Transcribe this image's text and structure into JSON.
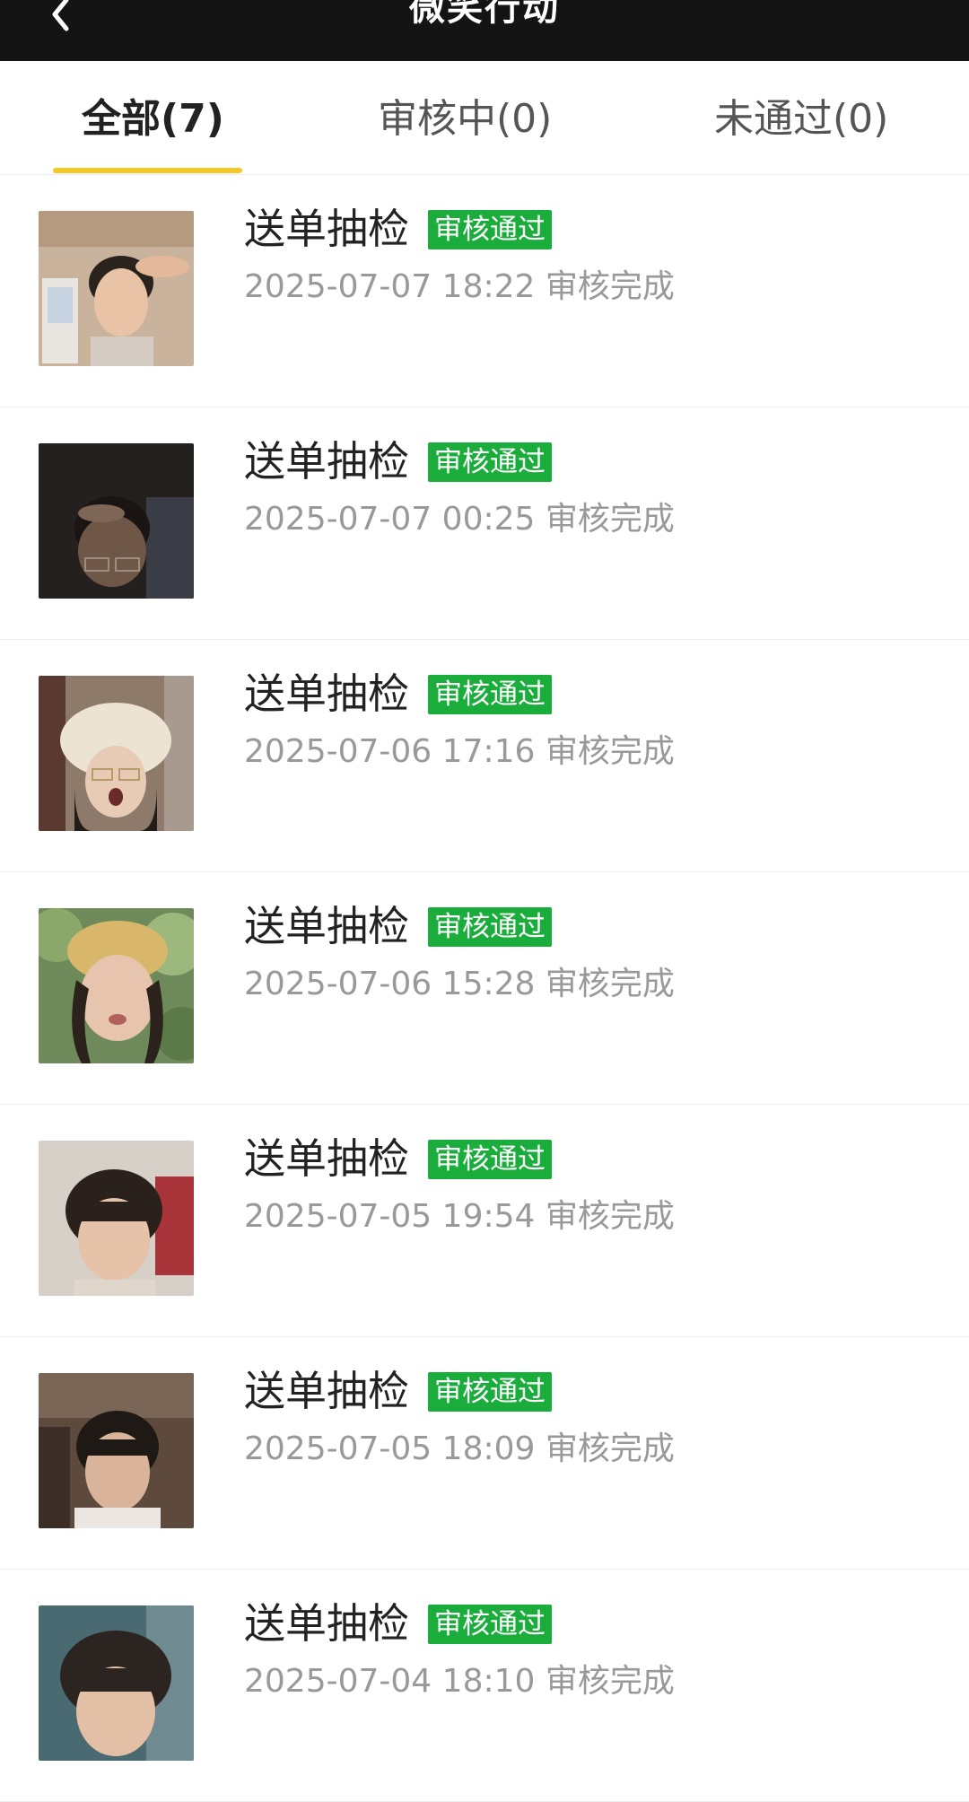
{
  "header": {
    "title": "微笑行动"
  },
  "tabs": [
    {
      "label": "全部(7)",
      "active": true
    },
    {
      "label": "审核中(0)",
      "active": false
    },
    {
      "label": "未通过(0)",
      "active": false
    }
  ],
  "colors": {
    "header_bg": "#141414",
    "tab_indicator": "#f6c823",
    "badge_bg": "#1aad3c",
    "subtext": "#999999"
  },
  "items": [
    {
      "title": "送单抽检",
      "badge": "审核通过",
      "subtitle": "2025-07-07 18:22 审核完成"
    },
    {
      "title": "送单抽检",
      "badge": "审核通过",
      "subtitle": "2025-07-07 00:25 审核完成"
    },
    {
      "title": "送单抽检",
      "badge": "审核通过",
      "subtitle": "2025-07-06 17:16 审核完成"
    },
    {
      "title": "送单抽检",
      "badge": "审核通过",
      "subtitle": "2025-07-06 15:28 审核完成"
    },
    {
      "title": "送单抽检",
      "badge": "审核通过",
      "subtitle": "2025-07-05 19:54 审核完成"
    },
    {
      "title": "送单抽检",
      "badge": "审核通过",
      "subtitle": "2025-07-05 18:09 审核完成"
    },
    {
      "title": "送单抽检",
      "badge": "审核通过",
      "subtitle": "2025-07-04 18:10 审核完成"
    }
  ]
}
